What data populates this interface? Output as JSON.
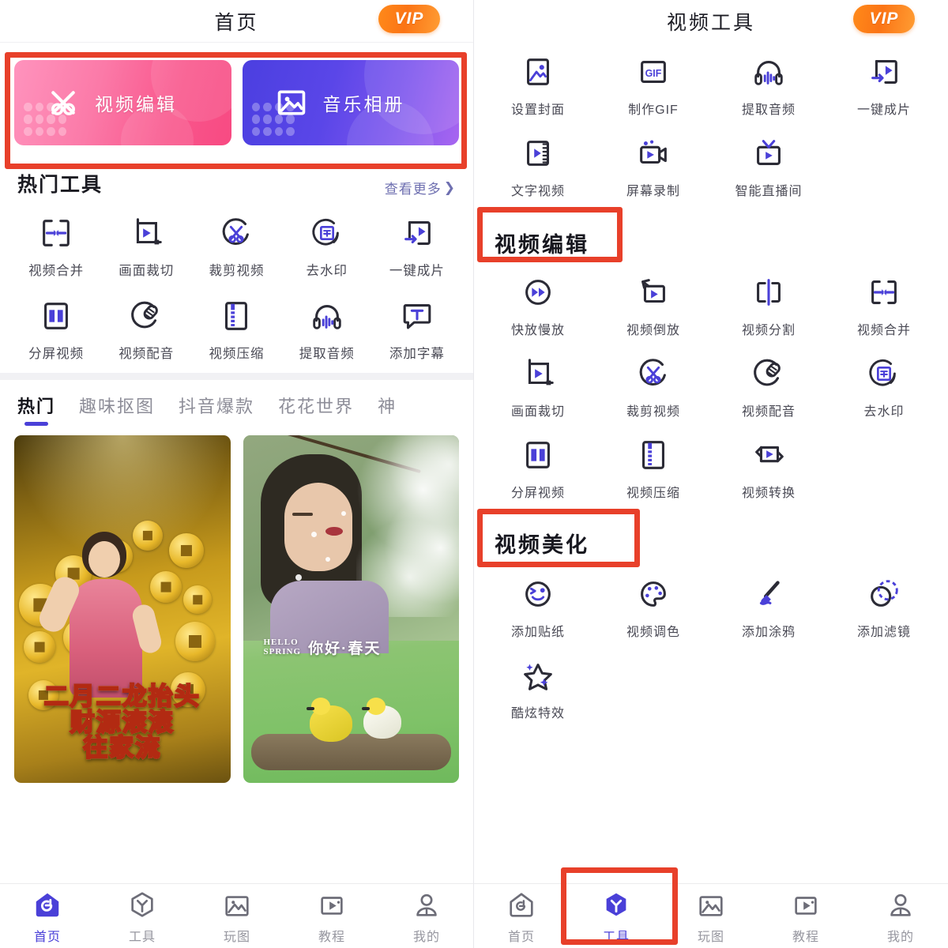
{
  "accent": "#4a40d8",
  "outline": "#2b2b36",
  "highlight_color": "#e8402a",
  "left": {
    "header": {
      "title": "首页",
      "vip_label": "VIP"
    },
    "banners": [
      {
        "label": "视频编辑",
        "icon": "scissors-x-icon",
        "theme": "pink"
      },
      {
        "label": "音乐相册",
        "icon": "photo-icon",
        "theme": "blue"
      }
    ],
    "section": {
      "title": "热门工具",
      "more_label": "查看更多",
      "more_chevron": "❯"
    },
    "tools": [
      {
        "label": "视频合并",
        "icon": "merge-icon"
      },
      {
        "label": "画面裁切",
        "icon": "crop-icon"
      },
      {
        "label": "裁剪视频",
        "icon": "scissors-circle-icon"
      },
      {
        "label": "去水印",
        "icon": "watermark-icon"
      },
      {
        "label": "一键成片",
        "icon": "one-click-icon"
      },
      {
        "label": "分屏视频",
        "icon": "split-screen-icon"
      },
      {
        "label": "视频配音",
        "icon": "dub-mic-icon"
      },
      {
        "label": "视频压缩",
        "icon": "compress-icon"
      },
      {
        "label": "提取音频",
        "icon": "headphones-icon"
      },
      {
        "label": "添加字幕",
        "icon": "subtitle-icon"
      }
    ],
    "tabs": [
      {
        "label": "热门",
        "active": true
      },
      {
        "label": "趣味抠图",
        "active": false
      },
      {
        "label": "抖音爆款",
        "active": false
      },
      {
        "label": "花花世界",
        "active": false
      },
      {
        "label": "神",
        "active": false
      }
    ],
    "cards": [
      {
        "theme": "gold",
        "lines": [
          "二月二龙抬头",
          "财源滚滚",
          "往家流"
        ]
      },
      {
        "theme": "green",
        "en_line1": "HELLO",
        "en_line2": "SPRING",
        "cn": "你好·春天"
      }
    ],
    "nav": [
      {
        "label": "首页",
        "icon": "home-icon",
        "active": true
      },
      {
        "label": "工具",
        "icon": "tools-hex-icon",
        "active": false
      },
      {
        "label": "玩图",
        "icon": "photo-play-icon",
        "active": false
      },
      {
        "label": "教程",
        "icon": "tutorial-play-icon",
        "active": false
      },
      {
        "label": "我的",
        "icon": "profile-icon",
        "active": false
      }
    ]
  },
  "right": {
    "header": {
      "title": "视频工具",
      "vip_label": "VIP"
    },
    "top_tools": [
      {
        "label": "设置封面",
        "icon": "cover-image-icon"
      },
      {
        "label": "制作GIF",
        "icon": "gif-icon"
      },
      {
        "label": "提取音频",
        "icon": "headphones-icon"
      },
      {
        "label": "一键成片",
        "icon": "one-click-icon"
      },
      {
        "label": "文字视频",
        "icon": "text-video-icon"
      },
      {
        "label": "屏幕录制",
        "icon": "screen-record-icon"
      },
      {
        "label": "智能直播间",
        "icon": "live-tv-icon"
      }
    ],
    "sections": [
      {
        "title": "视频编辑",
        "highlighted": true,
        "tools": [
          {
            "label": "快放慢放",
            "icon": "speed-icon"
          },
          {
            "label": "视频倒放",
            "icon": "reverse-icon"
          },
          {
            "label": "视频分割",
            "icon": "split-icon"
          },
          {
            "label": "视频合并",
            "icon": "merge-icon"
          },
          {
            "label": "画面裁切",
            "icon": "crop-icon"
          },
          {
            "label": "裁剪视频",
            "icon": "scissors-circle-icon"
          },
          {
            "label": "视频配音",
            "icon": "dub-mic-icon"
          },
          {
            "label": "去水印",
            "icon": "watermark-icon"
          },
          {
            "label": "分屏视频",
            "icon": "split-screen-icon"
          },
          {
            "label": "视频压缩",
            "icon": "compress-icon"
          },
          {
            "label": "视频转换",
            "icon": "convert-icon"
          }
        ]
      },
      {
        "title": "视频美化",
        "highlighted": true,
        "tools": [
          {
            "label": "添加贴纸",
            "icon": "sticker-face-icon"
          },
          {
            "label": "视频调色",
            "icon": "palette-icon"
          },
          {
            "label": "添加涂鸦",
            "icon": "brush-icon"
          },
          {
            "label": "添加滤镜",
            "icon": "filter-icon"
          },
          {
            "label": "酷炫特效",
            "icon": "star-effect-icon"
          }
        ]
      }
    ],
    "nav": [
      {
        "label": "首页",
        "icon": "home-icon",
        "active": false
      },
      {
        "label": "工具",
        "icon": "tools-hex-icon",
        "active": true,
        "highlighted": true
      },
      {
        "label": "玩图",
        "icon": "photo-play-icon",
        "active": false
      },
      {
        "label": "教程",
        "icon": "tutorial-play-icon",
        "active": false
      },
      {
        "label": "我的",
        "icon": "profile-icon",
        "active": false
      }
    ]
  }
}
